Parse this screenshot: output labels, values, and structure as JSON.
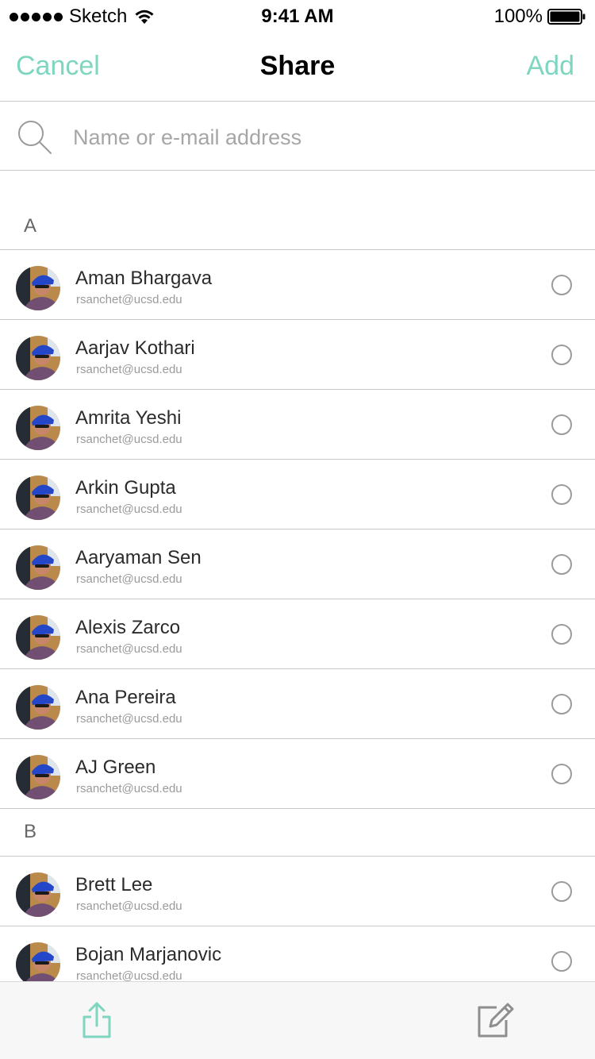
{
  "status_bar": {
    "carrier": "Sketch",
    "time": "9:41 AM",
    "battery": "100%"
  },
  "nav": {
    "cancel_label": "Cancel",
    "title": "Share",
    "add_label": "Add"
  },
  "search": {
    "placeholder": "Name or e-mail address",
    "value": ""
  },
  "sections": [
    {
      "letter": "A",
      "contacts": [
        {
          "name": "Aman Bhargava",
          "email": "rsanchet@ucsd.edu"
        },
        {
          "name": "Aarjav Kothari",
          "email": "rsanchet@ucsd.edu"
        },
        {
          "name": "Amrita Yeshi",
          "email": "rsanchet@ucsd.edu"
        },
        {
          "name": "Arkin Gupta",
          "email": "rsanchet@ucsd.edu"
        },
        {
          "name": "Aaryaman Sen",
          "email": "rsanchet@ucsd.edu"
        },
        {
          "name": "Alexis Zarco",
          "email": "rsanchet@ucsd.edu"
        },
        {
          "name": "Ana Pereira",
          "email": "rsanchet@ucsd.edu"
        },
        {
          "name": "AJ Green",
          "email": "rsanchet@ucsd.edu"
        }
      ]
    },
    {
      "letter": "B",
      "contacts": [
        {
          "name": "Brett Lee",
          "email": "rsanchet@ucsd.edu"
        },
        {
          "name": "Bojan Marjanovic",
          "email": "rsanchet@ucsd.edu"
        }
      ]
    }
  ],
  "toolbar": {
    "left_icon": "share-icon",
    "right_icon": "compose-icon"
  },
  "colors": {
    "accent": "#7ed6c0",
    "separator": "#c8c8cc",
    "radio_border": "#9b9b9b"
  }
}
